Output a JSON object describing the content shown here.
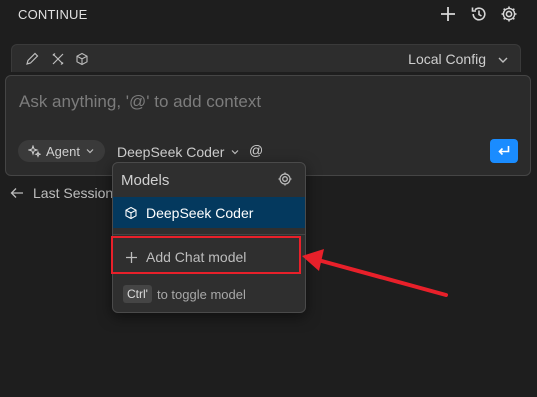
{
  "app": {
    "title": "CONTINUE"
  },
  "header_icons": [
    "plus-icon",
    "history-icon",
    "gear-icon"
  ],
  "config_bar": {
    "icons": [
      "pencil-icon",
      "tools-icon",
      "cube-icon"
    ],
    "label": "Local Config"
  },
  "input": {
    "placeholder": "Ask anything, '@' to add context",
    "mode_label": "Agent",
    "model_label": "DeepSeek Coder",
    "at_label": "@"
  },
  "last_session": {
    "label": "Last Session"
  },
  "models_dropdown": {
    "header": "Models",
    "selected_model": "DeepSeek Coder",
    "add_label": "Add Chat model",
    "footer_key": "Ctrl'",
    "footer_text": "to toggle model"
  },
  "colors": {
    "accent": "#1a8cff",
    "selected_bg": "#04395e",
    "annotation": "#e8202a"
  }
}
